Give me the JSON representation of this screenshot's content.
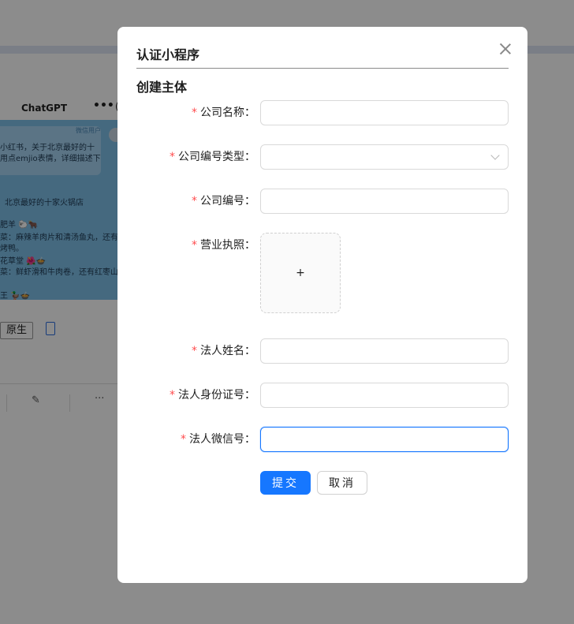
{
  "background": {
    "chat_app_name": "ChatGPT",
    "more_glyph": "•••",
    "chat_user_tag": "微信用户",
    "chat_lines": [
      "小红书，关于北京最好的十",
      "用点emjio表情，详细描述下",
      "北京最好的十家火锅店",
      "肥羊 🐑🐂",
      "菜：麻辣羊肉片和清汤鱼丸，还有香",
      "烤鸭。",
      "花草堂 🌺🍲",
      "菜：鲜虾滑和牛肉卷，还有红枣山药",
      "王 🦆🍲"
    ],
    "native_option_label": "原生",
    "toolbar_more": "···"
  },
  "modal": {
    "title": "认证小程序",
    "section_title": "创建主体",
    "fields": [
      {
        "label": "公司名称：",
        "type": "input",
        "value": "",
        "required": true
      },
      {
        "label": "公司编号类型：",
        "type": "select",
        "value": "",
        "required": true
      },
      {
        "label": "公司编号：",
        "type": "input",
        "value": "",
        "required": true
      },
      {
        "label": "营业执照：",
        "type": "upload",
        "upload_glyph": "+",
        "required": true
      },
      {
        "label": "法人姓名：",
        "type": "input",
        "value": "",
        "required": true
      },
      {
        "label": "法人身份证号：",
        "type": "input",
        "value": "",
        "required": true
      },
      {
        "label": "法人微信号：",
        "type": "input",
        "value": "",
        "required": true,
        "focused": true
      }
    ],
    "required_mark": "*",
    "submit_label": "提交",
    "cancel_label": "取消"
  },
  "colors": {
    "primary": "#1677ff",
    "required": "#ff4d4f",
    "overlay": "rgba(0,0,0,0.45)"
  }
}
